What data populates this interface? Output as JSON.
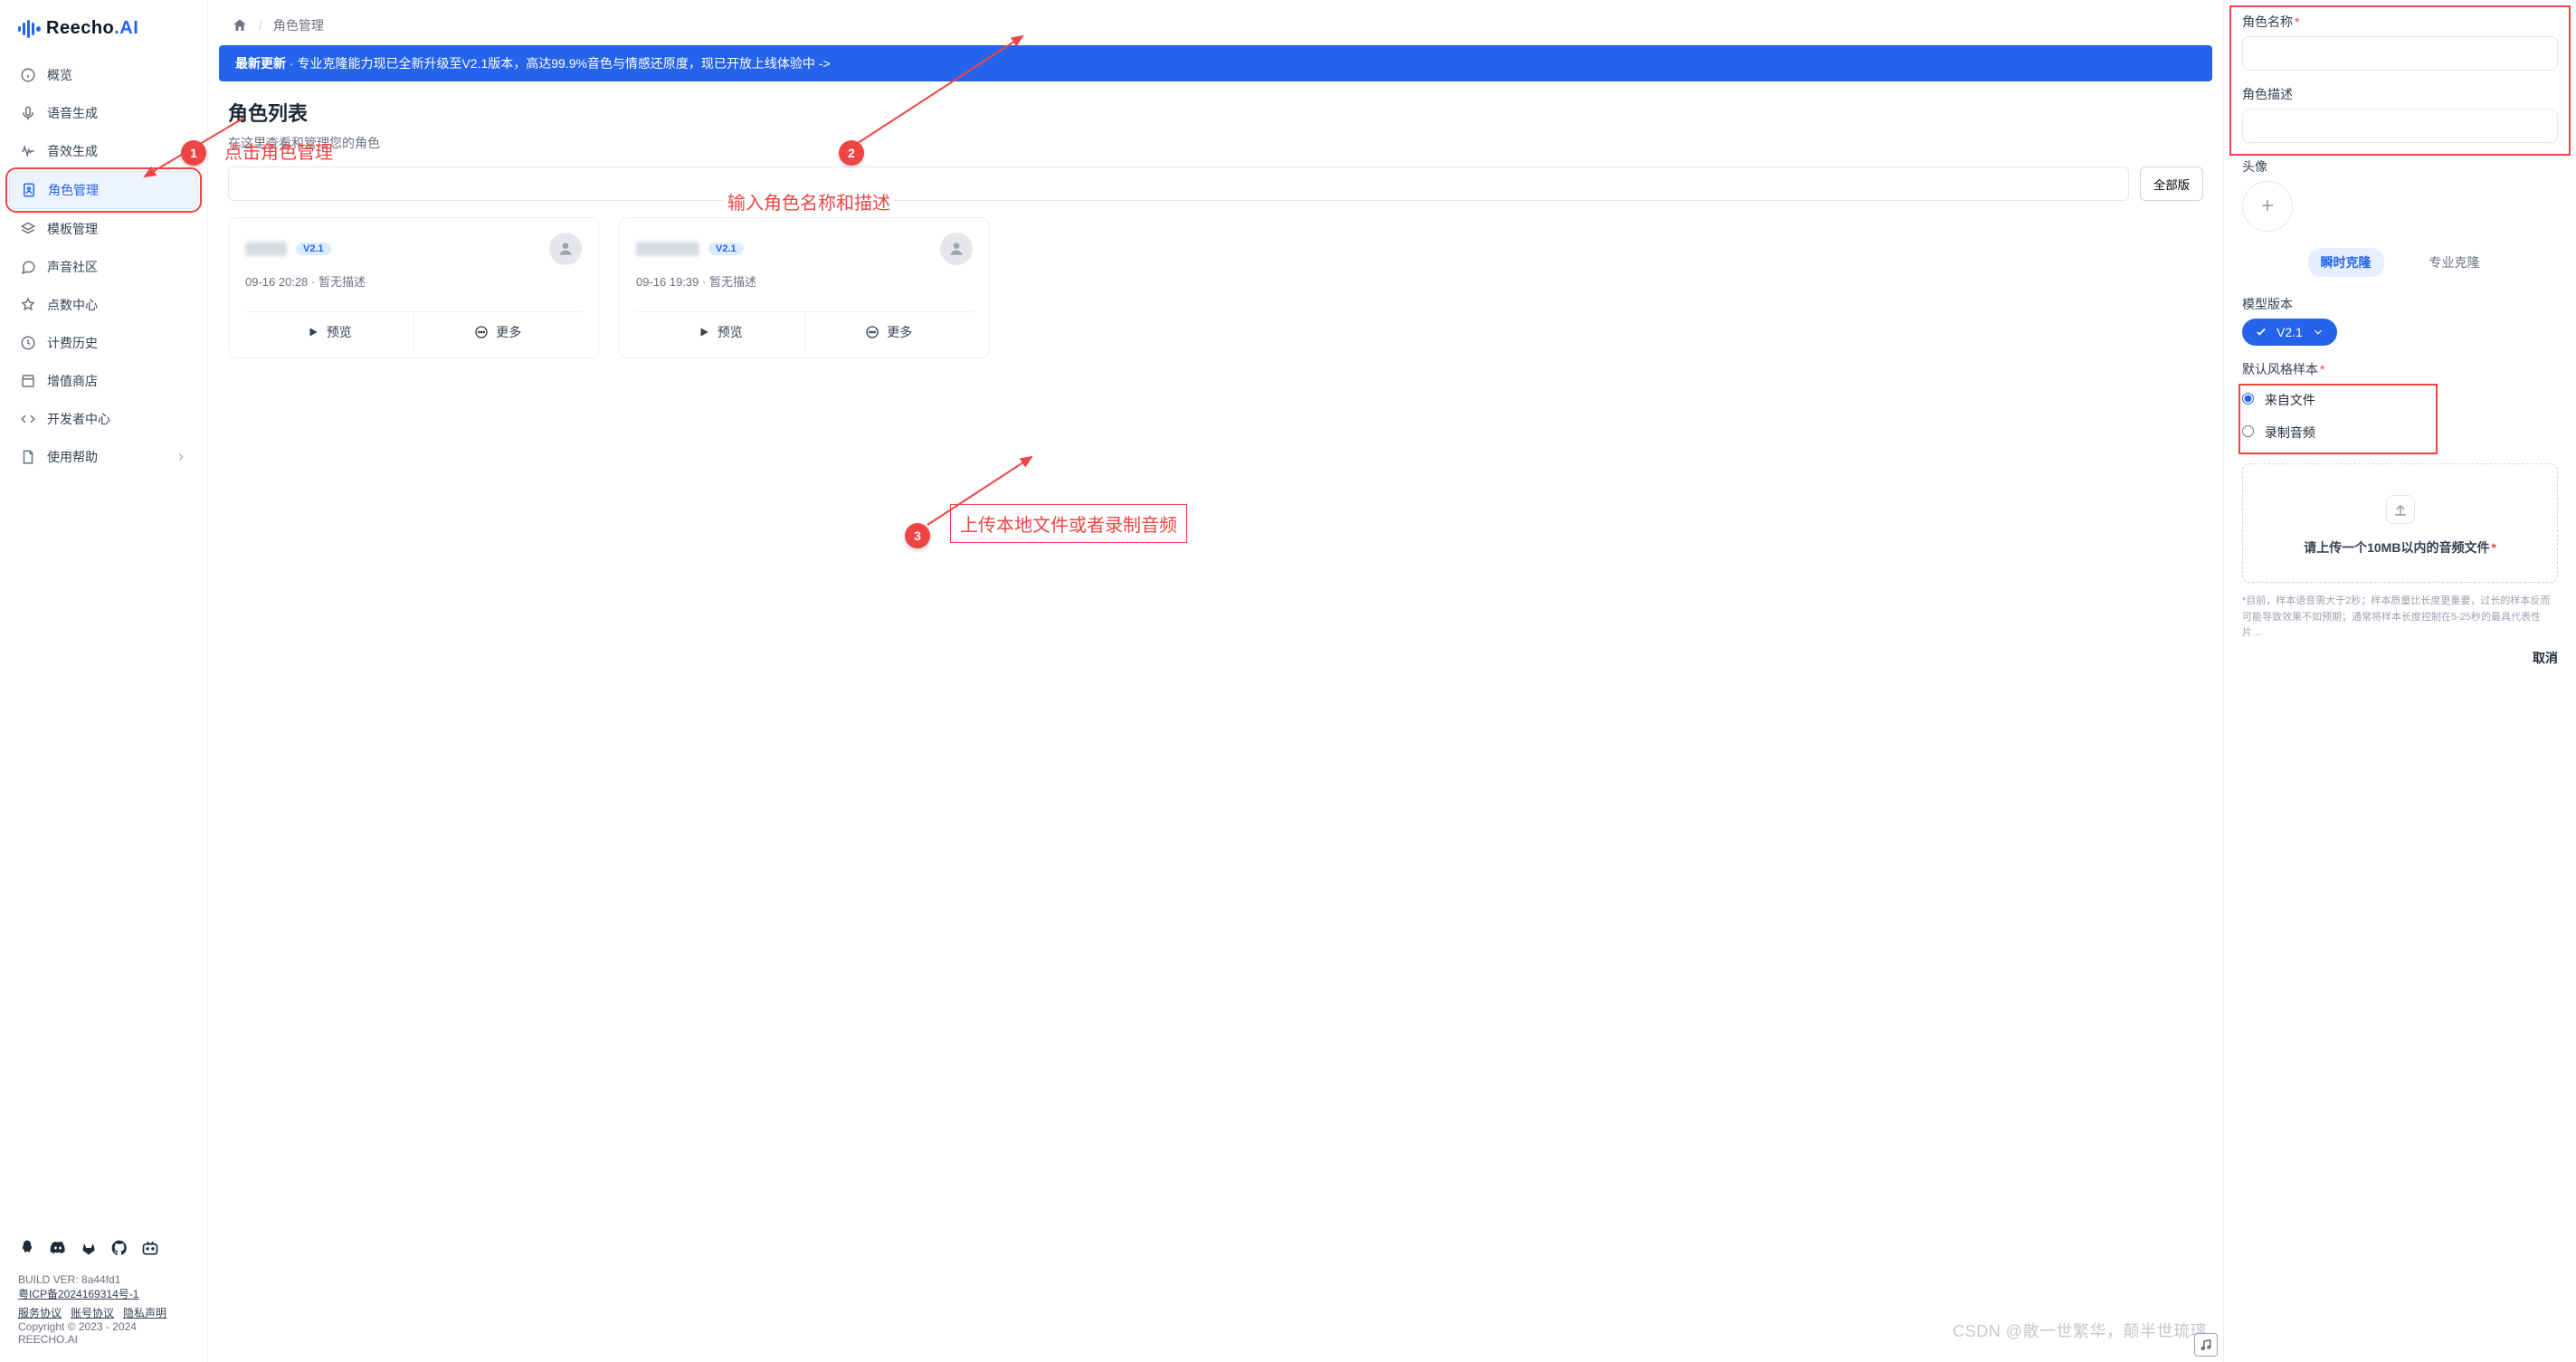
{
  "logo": {
    "text": "Reecho",
    "suffix": ".AI"
  },
  "sidebar": {
    "items": [
      {
        "label": "概览",
        "icon": "info"
      },
      {
        "label": "语音生成",
        "icon": "mic"
      },
      {
        "label": "音效生成",
        "icon": "waves"
      },
      {
        "label": "角色管理",
        "icon": "user-doc",
        "active": true
      },
      {
        "label": "模板管理",
        "icon": "layers"
      },
      {
        "label": "声音社区",
        "icon": "chat"
      },
      {
        "label": "点数中心",
        "icon": "star"
      },
      {
        "label": "计费历史",
        "icon": "clock"
      },
      {
        "label": "增值商店",
        "icon": "store"
      },
      {
        "label": "开发者中心",
        "icon": "code"
      },
      {
        "label": "使用帮助",
        "icon": "file",
        "chevron": true
      }
    ]
  },
  "footer": {
    "build": "BUILD VER: 8a44fd1",
    "icp": "粤ICP备2024169314号-1",
    "links": [
      "服务协议",
      "账号协议",
      "隐私声明"
    ],
    "copyright": "Copyright © 2023 - 2024 REECHO.AI"
  },
  "breadcrumb": {
    "current": "角色管理"
  },
  "banner": {
    "tag": "最新更新",
    "text": " · 专业克隆能力现已全新升级至V2.1版本，高达99.9%音色与情感还原度，现已开放上线体验中 ->"
  },
  "list": {
    "title": "角色列表",
    "subtitle": "在这里查看和管理您的角色",
    "search_placeholder": "",
    "filter_button": "全部版",
    "cards": [
      {
        "version": "V2.1",
        "meta": "09-16 20:28 · 暂无描述",
        "preview": "预览",
        "more": "更多"
      },
      {
        "version": "V2.1",
        "meta": "09-16 19:39 · 暂无描述",
        "preview": "预览",
        "more": "更多"
      }
    ]
  },
  "form": {
    "name_label": "角色名称",
    "desc_label": "角色描述",
    "avatar_label": "头像",
    "tabs": {
      "instant": "瞬时克隆",
      "pro": "专业克隆"
    },
    "version_label": "模型版本",
    "version_value": "V2.1",
    "sample_label": "默认风格样本",
    "radio_file": "来自文件",
    "radio_record": "录制音频",
    "upload_text": "请上传一个10MB以内的音频文件",
    "fine_print": "*目前，样本语音需大于2秒；样本质量比长度更重要，过长的样本反而可能导致效果不如预期；通常将样本长度控制在5-25秒的最具代表性片…",
    "cancel": "取消"
  },
  "annotations": {
    "step1": "1",
    "step1_text": "点击角色管理",
    "step2": "2",
    "step2_text": "输入角色名称和描述",
    "step3": "3",
    "step3_text": "上传本地文件或者录制音频"
  },
  "watermark": "CSDN @散一世繁华，颠半世琉璃"
}
